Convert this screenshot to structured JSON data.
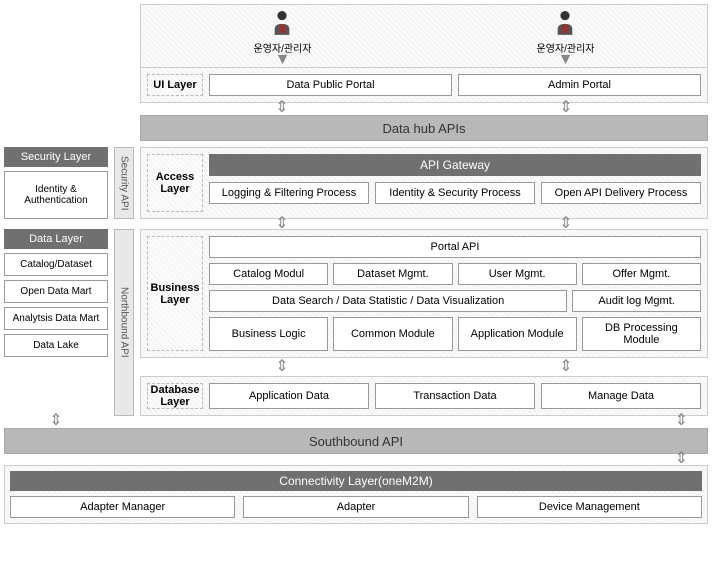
{
  "actors": {
    "left": "운영자/관리자",
    "right": "운영자/관리자"
  },
  "ui_layer": {
    "label": "UI Layer",
    "boxes": [
      "Data Public Portal",
      "Admin Portal"
    ]
  },
  "data_hub_bar": "Data hub APIs",
  "security_layer": {
    "header": "Security Layer",
    "box": "Identity & Authentication"
  },
  "security_api_label": "Security API",
  "access_layer": {
    "label": "Access Layer",
    "gateway": "API Gateway",
    "boxes": [
      "Logging & Filtering Process",
      "Identity & Security Process",
      "Open API Delivery Process"
    ]
  },
  "data_layer": {
    "header": "Data Layer",
    "boxes": [
      "Catalog/Dataset",
      "Open Data Mart",
      "Analytsis Data Mart",
      "Data Lake"
    ]
  },
  "northbound_label": "Northbound API",
  "business_layer": {
    "label": "Business Layer",
    "portal_api": "Portal API",
    "row1": [
      "Catalog Modul",
      "Dataset Mgmt.",
      "User Mgmt.",
      "Offer Mgmt."
    ],
    "row2_left": "Data Search / Data Statistic / Data Visualization",
    "row2_right": "Audit log Mgmt.",
    "row3": [
      "Business Logic",
      "Common Module",
      "Application Module",
      "DB Processing Module"
    ]
  },
  "database_layer": {
    "label": "Database Layer",
    "boxes": [
      "Application Data",
      "Transaction Data",
      "Manage Data"
    ]
  },
  "southbound_bar": "Southbound API",
  "connectivity": {
    "header": "Connectivity Layer(oneM2M)",
    "boxes": [
      "Adapter Manager",
      "Adapter",
      "Device Management"
    ]
  }
}
